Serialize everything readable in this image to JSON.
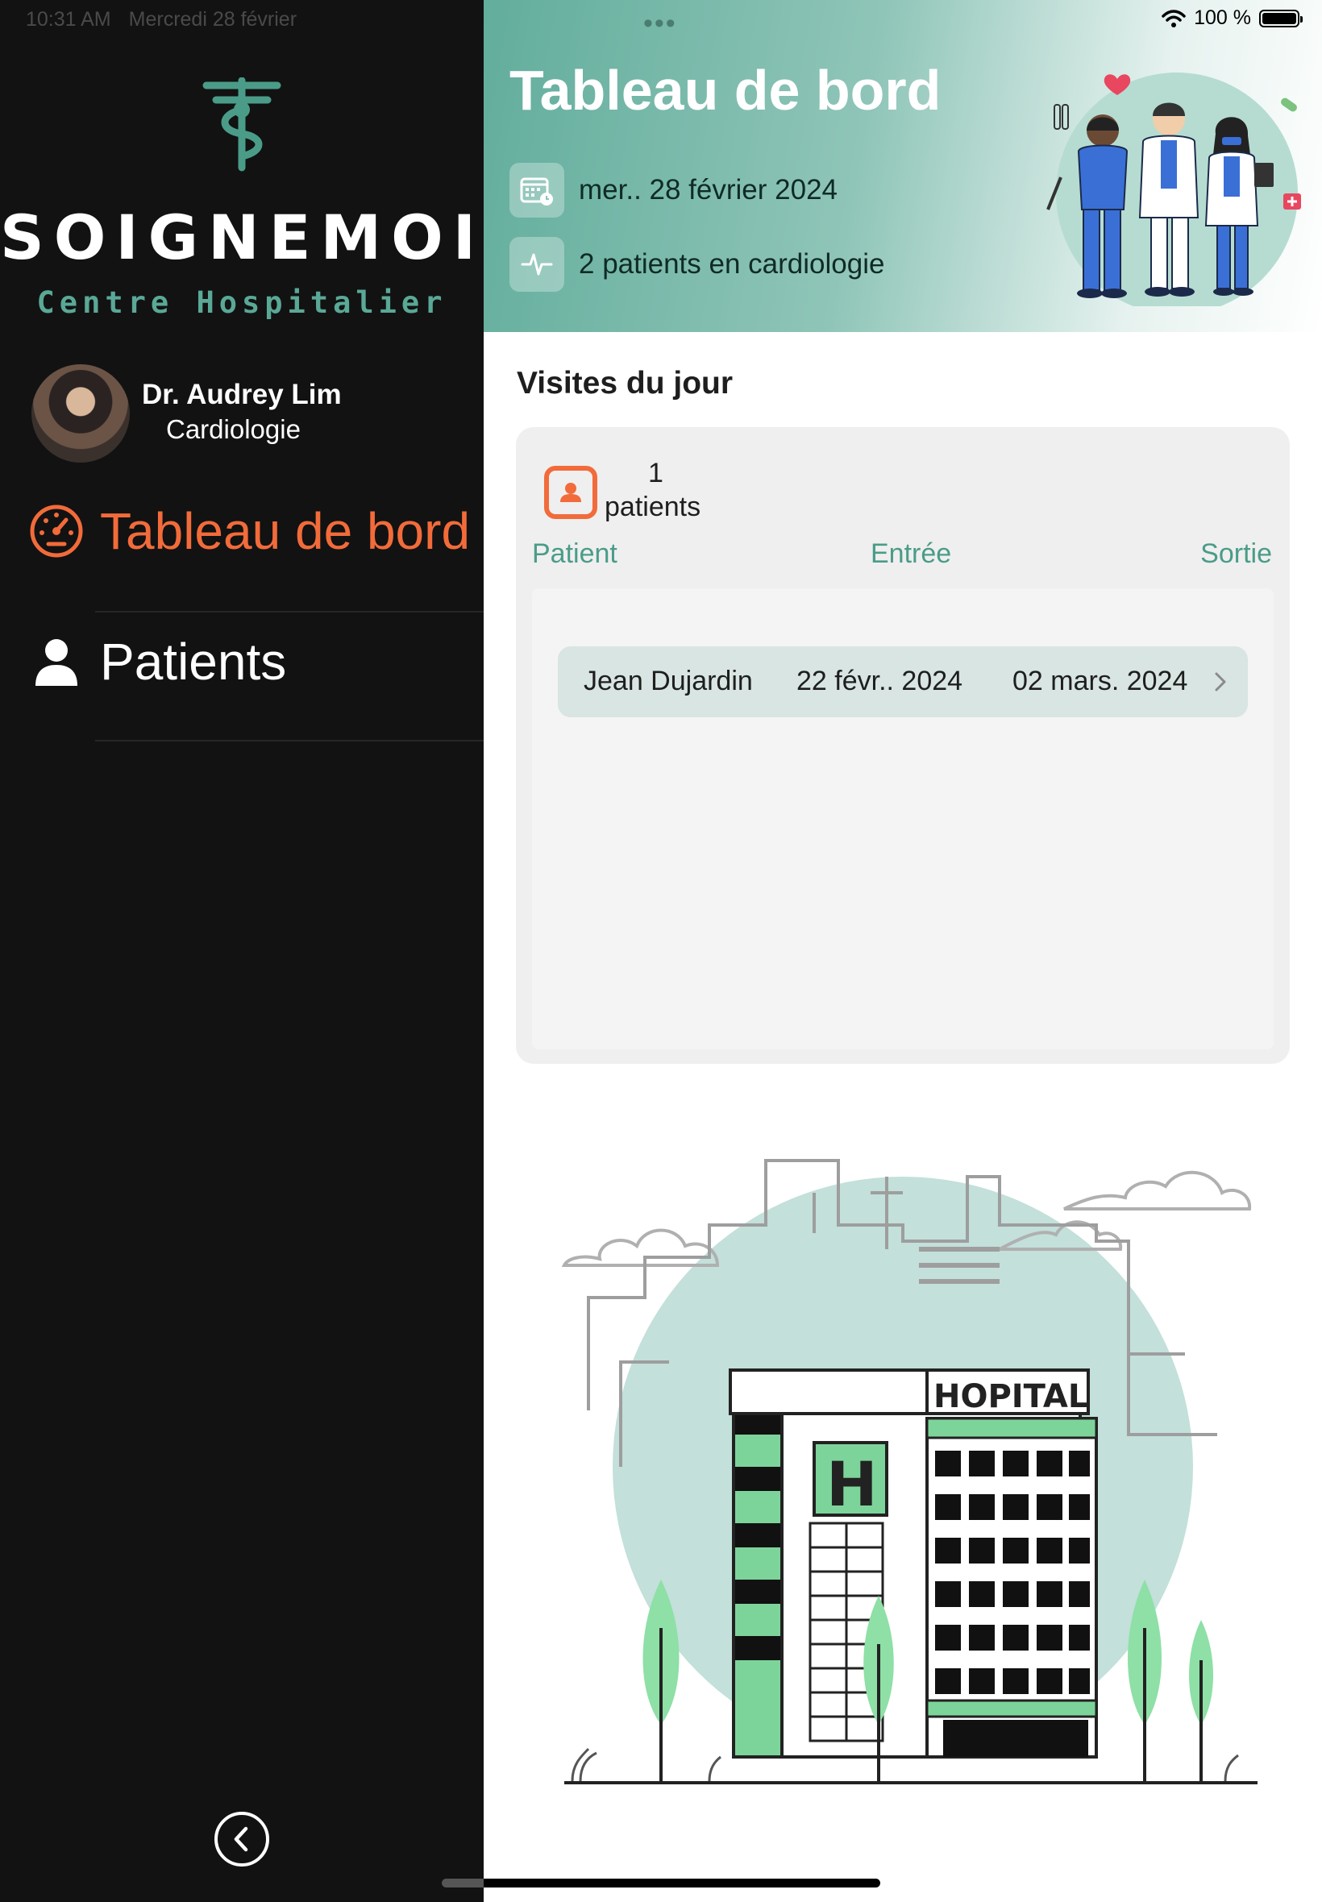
{
  "status_bar": {
    "time": "10:31 AM",
    "date": "Mercredi 28 février",
    "battery": "100 %",
    "dots": "•••"
  },
  "brand": {
    "name": "SOIGNEMOI",
    "subtitle": "Centre Hospitalier",
    "accent_color": "#5aa896"
  },
  "user": {
    "name": "Dr. Audrey Lim",
    "specialty": "Cardiologie"
  },
  "sidebar": {
    "items": [
      {
        "label": "Tableau de bord",
        "icon": "dashboard-gauge-icon",
        "active": true
      },
      {
        "label": "Patients",
        "icon": "person-icon",
        "active": false
      }
    ],
    "active_color": "#f26b3a"
  },
  "header": {
    "title": "Tableau de bord",
    "date_text": "mer.. 28 février 2024",
    "patients_text": "2 patients en cardiologie"
  },
  "visits": {
    "title": "Visites du jour",
    "count": "1",
    "count_label": "patients",
    "columns": [
      "Patient",
      "Entrée",
      "Sortie"
    ],
    "rows": [
      {
        "patient": "Jean Dujardin",
        "entree": "22 févr.. 2024",
        "sortie": "02 mars. 2024"
      }
    ]
  },
  "illustration": {
    "hospital_sign": "HOPITAL",
    "sign_letter": "H"
  }
}
